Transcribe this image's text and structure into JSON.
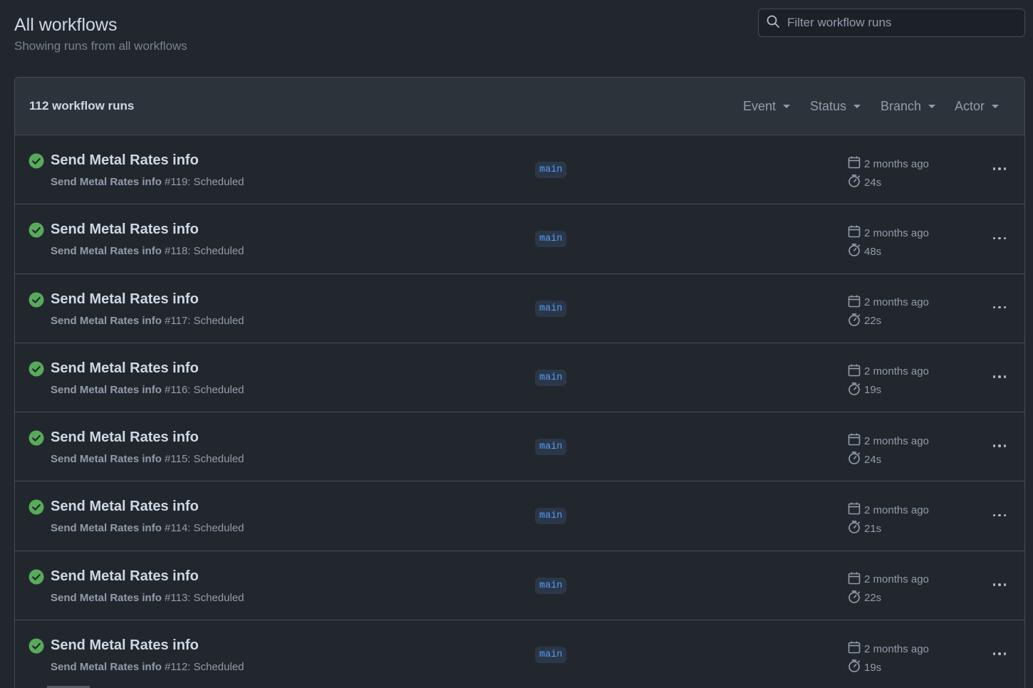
{
  "header": {
    "title": "All workflows",
    "subtitle": "Showing runs from all workflows"
  },
  "search": {
    "placeholder": "Filter workflow runs",
    "icon": "search-icon"
  },
  "list": {
    "count_label": "112 workflow runs",
    "filters": [
      {
        "label": "Event"
      },
      {
        "label": "Status"
      },
      {
        "label": "Branch"
      },
      {
        "label": "Actor"
      }
    ],
    "runs": [
      {
        "title": "Send Metal Rates info",
        "workflow": "Send Metal Rates info",
        "detail": "#119: Scheduled",
        "branch": "main",
        "when": "2 months ago",
        "duration": "24s",
        "status": "success"
      },
      {
        "title": "Send Metal Rates info",
        "workflow": "Send Metal Rates info",
        "detail": "#118: Scheduled",
        "branch": "main",
        "when": "2 months ago",
        "duration": "48s",
        "status": "success"
      },
      {
        "title": "Send Metal Rates info",
        "workflow": "Send Metal Rates info",
        "detail": "#117: Scheduled",
        "branch": "main",
        "when": "2 months ago",
        "duration": "22s",
        "status": "success"
      },
      {
        "title": "Send Metal Rates info",
        "workflow": "Send Metal Rates info",
        "detail": "#116: Scheduled",
        "branch": "main",
        "when": "2 months ago",
        "duration": "19s",
        "status": "success"
      },
      {
        "title": "Send Metal Rates info",
        "workflow": "Send Metal Rates info",
        "detail": "#115: Scheduled",
        "branch": "main",
        "when": "2 months ago",
        "duration": "24s",
        "status": "success"
      },
      {
        "title": "Send Metal Rates info",
        "workflow": "Send Metal Rates info",
        "detail": "#114: Scheduled",
        "branch": "main",
        "when": "2 months ago",
        "duration": "21s",
        "status": "success"
      },
      {
        "title": "Send Metal Rates info",
        "workflow": "Send Metal Rates info",
        "detail": "#113: Scheduled",
        "branch": "main",
        "when": "2 months ago",
        "duration": "22s",
        "status": "success"
      },
      {
        "title": "Send Metal Rates info",
        "workflow": "Send Metal Rates info",
        "detail": "#112: Scheduled",
        "branch": "main",
        "when": "2 months ago",
        "duration": "19s",
        "status": "success"
      }
    ]
  },
  "colors": {
    "background": "#22272e",
    "header_bg": "#2d333b",
    "border": "#444c56",
    "success": "#57ab5a",
    "branch_text": "#539bf5",
    "branch_bg": "#2b3748"
  }
}
